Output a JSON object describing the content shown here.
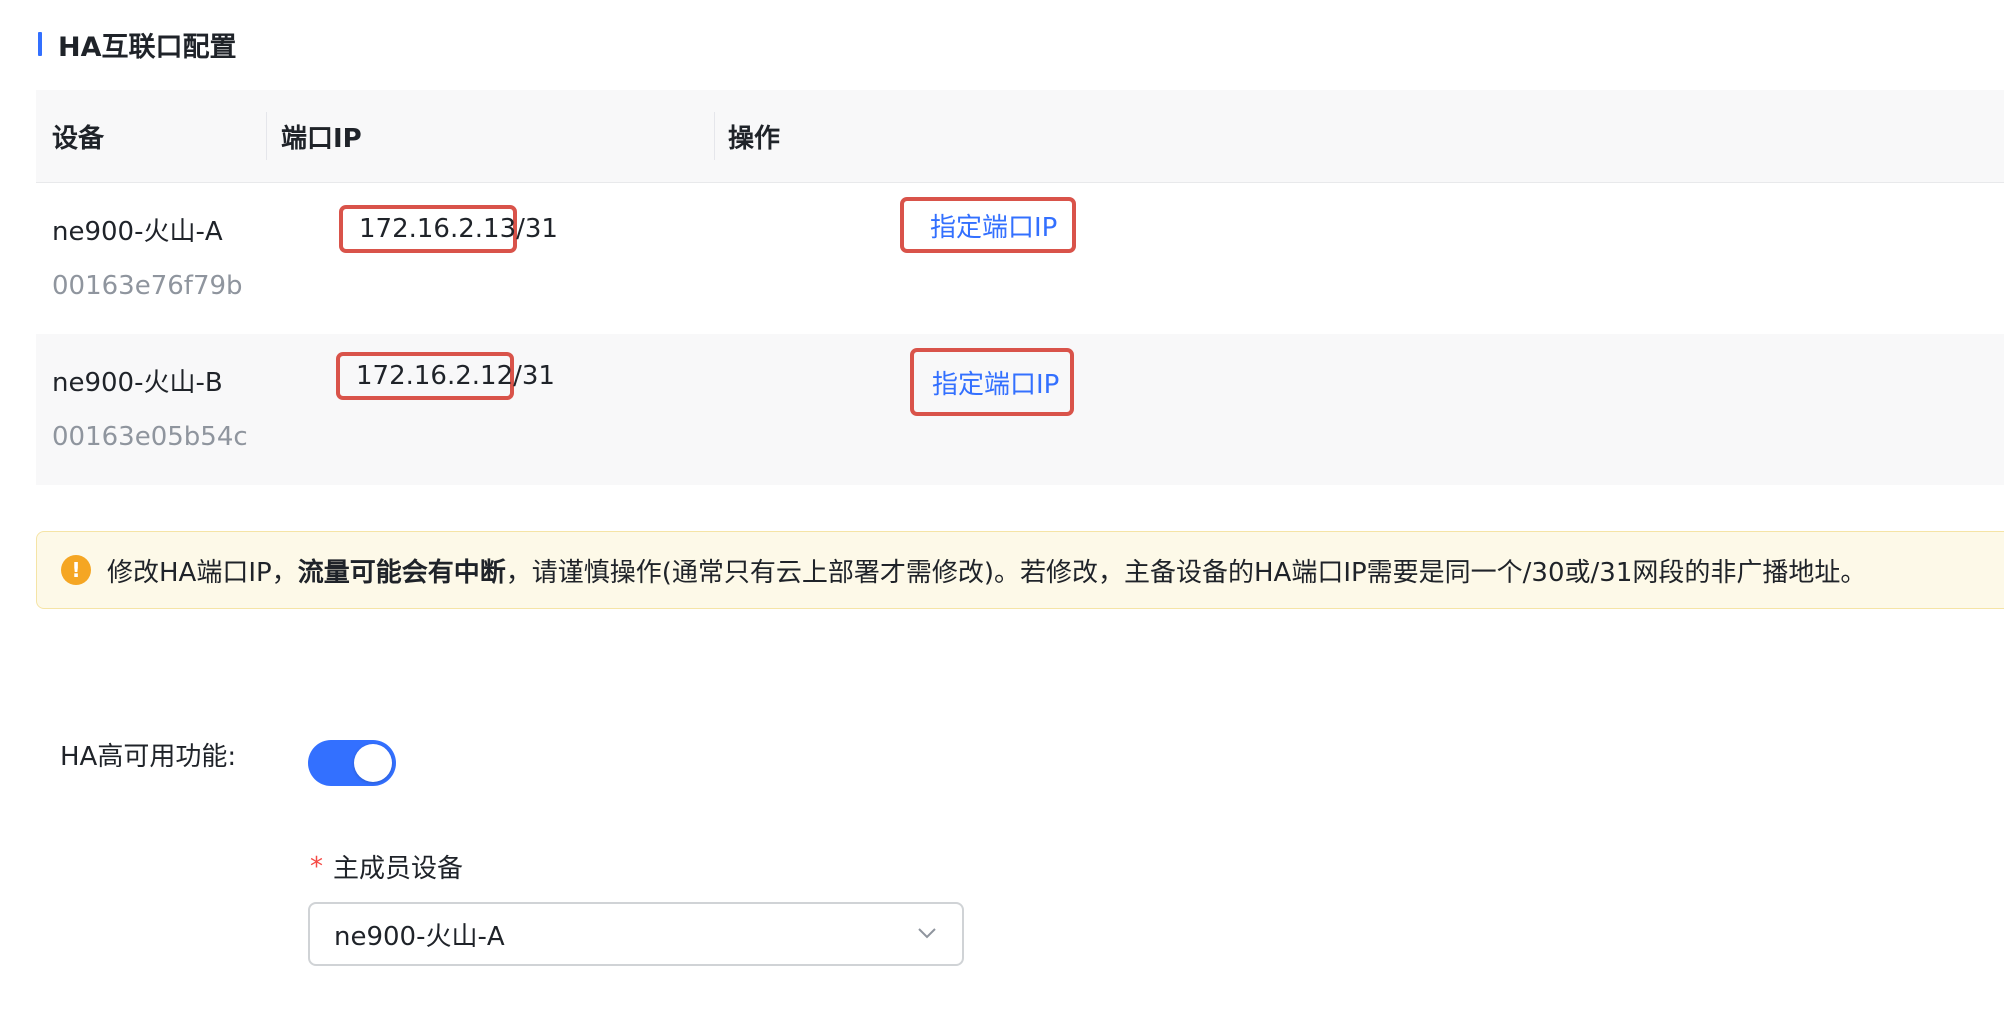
{
  "section": {
    "title": "HA互联口配置"
  },
  "table": {
    "headers": [
      "设备",
      "端口IP",
      "操作"
    ],
    "rows": [
      {
        "device_name": "ne900-火山-A",
        "device_mac": "00163e76f79b",
        "port_ip": "172.16.2.13/31",
        "action_label": "指定端口IP"
      },
      {
        "device_name": "ne900-火山-B",
        "device_mac": "00163e05b54c",
        "port_ip": "172.16.2.12/31",
        "action_label": "指定端口IP"
      }
    ]
  },
  "alert": {
    "icon": "warning-icon",
    "text_before": "修改HA端口IP，",
    "text_bold": "流量可能会有中断",
    "text_after": "，请谨慎操作(通常只有云上部署才需修改)。若修改，主备设备的HA端口IP需要是同一个/30或/31网段的非广播地址。"
  },
  "ha": {
    "label": "HA高可用功能:",
    "enabled": true
  },
  "primary_device": {
    "required_mark": "*",
    "label": "主成员设备",
    "value": "ne900-火山-A"
  },
  "colors": {
    "accent": "#3370ff",
    "highlight_box": "#d9534a",
    "warning": "#f5a623"
  }
}
